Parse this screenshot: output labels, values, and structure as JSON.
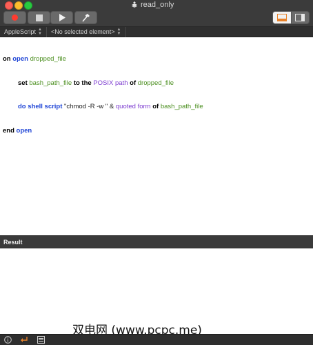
{
  "window": {
    "title": "read_only"
  },
  "toolbar": {
    "record": "record-icon",
    "stop": "stop-icon",
    "run": "run-icon",
    "compile": "hammer-icon"
  },
  "navbar": {
    "language": "AppleScript",
    "element": "<No selected element>"
  },
  "script": {
    "line1": {
      "kw_on": "on",
      "kw_open": "open",
      "var": "dropped_file"
    },
    "line2": {
      "kw_set": "set",
      "var1": "bash_path_file",
      "kw_to": "to the",
      "prop": "POSIX path",
      "kw_of": "of",
      "var2": "dropped_file"
    },
    "line3": {
      "kw_do": "do shell script",
      "str": "\"chmod -R -w \" &",
      "prop": "quoted form",
      "kw_of": "of",
      "var": "bash_path_file"
    },
    "line4": {
      "kw_end": "end",
      "kw_open": "open"
    }
  },
  "result": {
    "title": "Result",
    "watermark": "双电网 (www.pcpc.me)"
  },
  "colors": {
    "keyword_blue": "#1e44d6",
    "variable_green": "#4b8f1f",
    "property_purple": "#7d3cd0",
    "record_red": "#ff3b30",
    "return_orange": "#e8822a"
  }
}
